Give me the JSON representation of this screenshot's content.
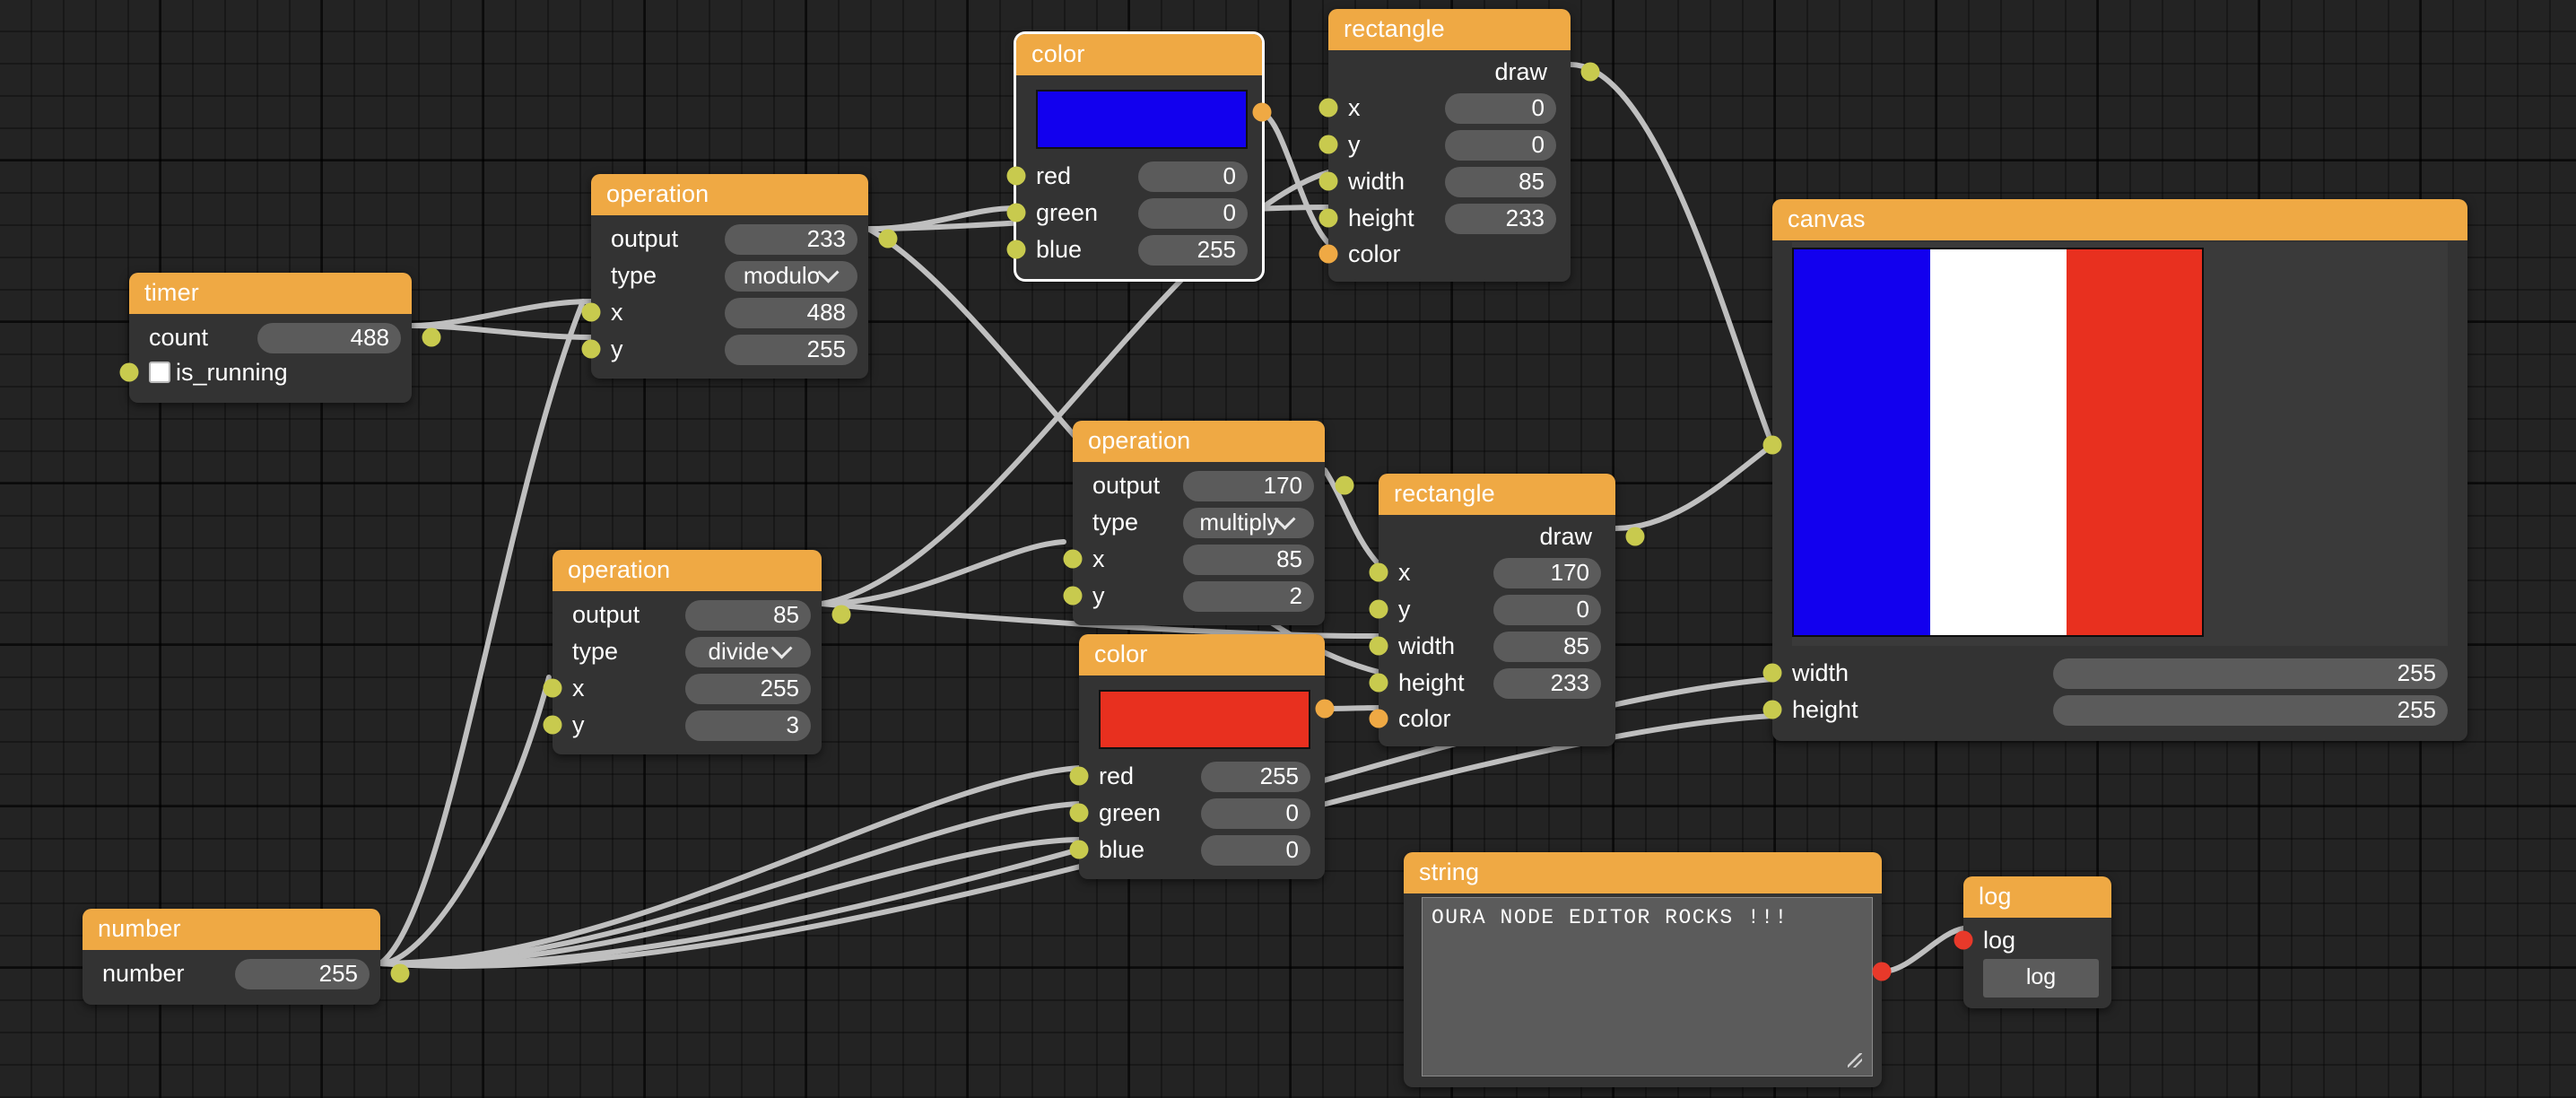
{
  "app": {
    "editor_name": "node-editor",
    "background": "#232323",
    "node_header_color": "#efa944",
    "wire_color": "#bfbfbf"
  },
  "nodes": {
    "timer": {
      "title": "timer",
      "rows": [
        {
          "label": "count",
          "value": "488"
        },
        {
          "label": "is_running",
          "value": ""
        }
      ]
    },
    "op_modulo": {
      "title": "operation",
      "rows": [
        {
          "label": "output",
          "value": "233"
        },
        {
          "label": "type",
          "value": "modulo"
        },
        {
          "label": "x",
          "value": "488"
        },
        {
          "label": "y",
          "value": "255"
        }
      ]
    },
    "op_divide": {
      "title": "operation",
      "rows": [
        {
          "label": "output",
          "value": "85"
        },
        {
          "label": "type",
          "value": "divide"
        },
        {
          "label": "x",
          "value": "255"
        },
        {
          "label": "y",
          "value": "3"
        }
      ]
    },
    "op_multiply": {
      "title": "operation",
      "rows": [
        {
          "label": "output",
          "value": "170"
        },
        {
          "label": "type",
          "value": "multiply"
        },
        {
          "label": "x",
          "value": "85"
        },
        {
          "label": "y",
          "value": "2"
        }
      ]
    },
    "color_blue": {
      "title": "color",
      "swatch": "#1200ee",
      "selected": true,
      "rows": [
        {
          "label": "red",
          "value": "0"
        },
        {
          "label": "green",
          "value": "0"
        },
        {
          "label": "blue",
          "value": "255"
        }
      ]
    },
    "color_red": {
      "title": "color",
      "swatch": "#e8301f",
      "selected": false,
      "rows": [
        {
          "label": "red",
          "value": "255"
        },
        {
          "label": "green",
          "value": "0"
        },
        {
          "label": "blue",
          "value": "0"
        }
      ]
    },
    "rect_blue": {
      "title": "rectangle",
      "output_label": "draw",
      "rows": [
        {
          "label": "x",
          "value": "0"
        },
        {
          "label": "y",
          "value": "0"
        },
        {
          "label": "width",
          "value": "85"
        },
        {
          "label": "height",
          "value": "233"
        },
        {
          "label": "color",
          "value": ""
        }
      ]
    },
    "rect_red": {
      "title": "rectangle",
      "output_label": "draw",
      "rows": [
        {
          "label": "x",
          "value": "170"
        },
        {
          "label": "y",
          "value": "0"
        },
        {
          "label": "width",
          "value": "85"
        },
        {
          "label": "height",
          "value": "233"
        },
        {
          "label": "color",
          "value": ""
        }
      ]
    },
    "number": {
      "title": "number",
      "rows": [
        {
          "label": "number",
          "value": "255"
        }
      ]
    },
    "canvas": {
      "title": "canvas",
      "rows": [
        {
          "label": "width",
          "value": "255"
        },
        {
          "label": "height",
          "value": "255"
        }
      ],
      "flag_stripes": [
        {
          "name": "blue-stripe",
          "color": "#1200ee"
        },
        {
          "name": "white-stripe",
          "color": "#ffffff"
        },
        {
          "name": "red-stripe",
          "color": "#e8301f"
        }
      ]
    },
    "string": {
      "title": "string",
      "text": "OURA NODE EDITOR ROCKS !!!"
    },
    "log": {
      "title": "log",
      "input_label": "log",
      "button_label": "log"
    }
  }
}
